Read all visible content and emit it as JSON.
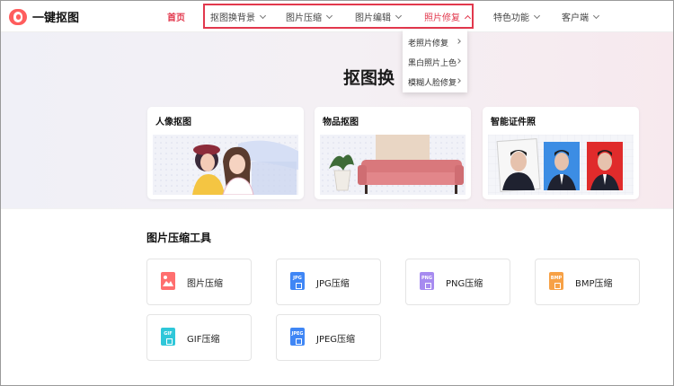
{
  "header": {
    "logo_text": "一键抠图",
    "nav": [
      {
        "label": "首页"
      },
      {
        "label": "抠图换背景"
      },
      {
        "label": "图片压缩"
      },
      {
        "label": "图片编辑"
      },
      {
        "label": "照片修复"
      },
      {
        "label": "特色功能"
      },
      {
        "label": "客户端"
      }
    ]
  },
  "dropdown": {
    "items": [
      {
        "label": "老照片修复"
      },
      {
        "label": "黑白照片上色"
      },
      {
        "label": "模糊人脸修复"
      }
    ]
  },
  "hero": {
    "title": "抠图换",
    "cards": [
      {
        "title": "人像抠图"
      },
      {
        "title": "物品抠图"
      },
      {
        "title": "智能证件照"
      }
    ]
  },
  "tools": {
    "title": "图片压缩工具",
    "items": [
      {
        "label": "图片压缩",
        "icon": "image-compress-icon",
        "color": "#ff6f6f"
      },
      {
        "label": "JPG压缩",
        "icon_text": "JPG",
        "color": "#3f86f5"
      },
      {
        "label": "PNG压缩",
        "icon_text": "PNG",
        "color": "#a78bf0"
      },
      {
        "label": "BMP压缩",
        "icon_text": "BMP",
        "color": "#f7a146"
      },
      {
        "label": "GIF压缩",
        "icon_text": "GIF",
        "color": "#2fc7d9"
      },
      {
        "label": "JPEG压缩",
        "icon_text": "JPEG",
        "color": "#3f86f5"
      }
    ]
  },
  "colors": {
    "accent": "#e2384d"
  }
}
